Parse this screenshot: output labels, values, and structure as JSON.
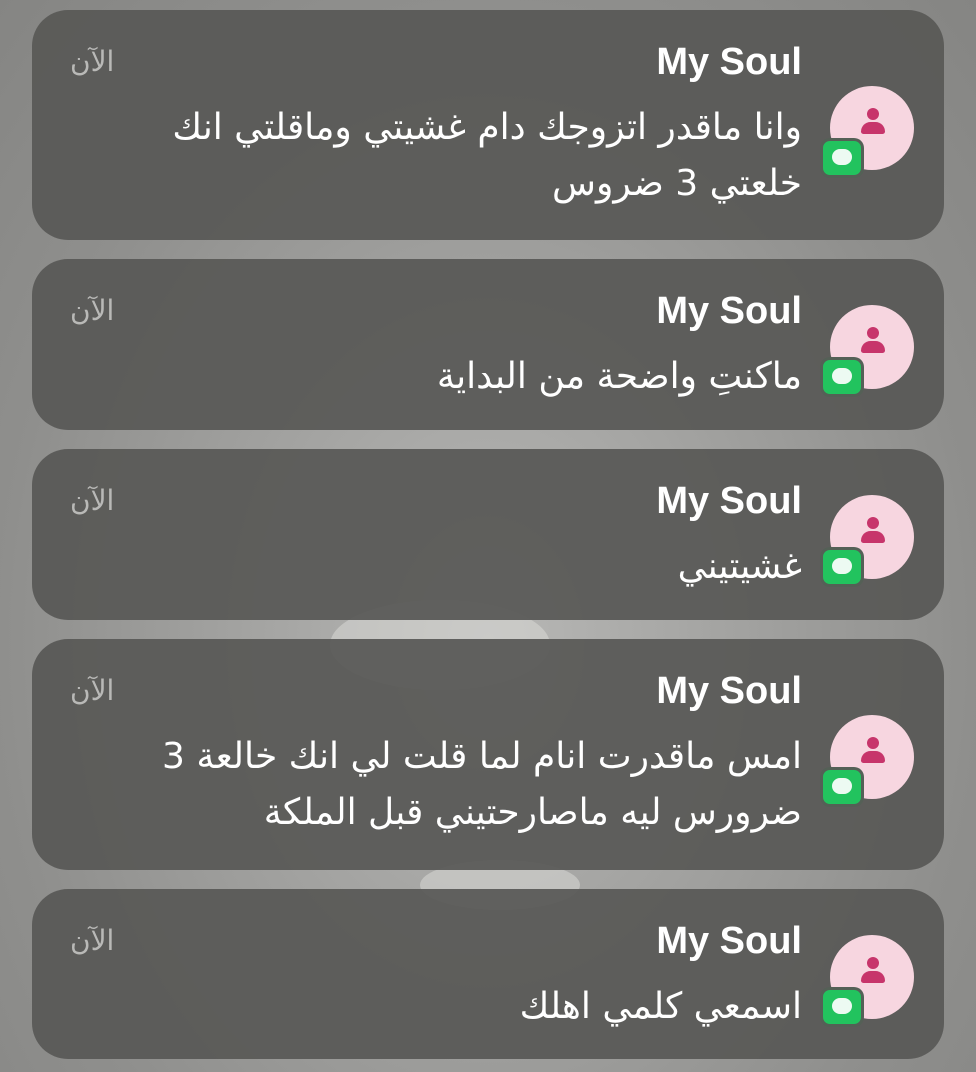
{
  "notifications": [
    {
      "sender": "My Soul",
      "time": "الآن",
      "message": "وانا ماقدر اتزوجك دام غشيتي وماقلتي انك خلعتي 3 ضروس"
    },
    {
      "sender": "My Soul",
      "time": "الآن",
      "message": "ماكنتِ واضحة من البداية"
    },
    {
      "sender": "My Soul",
      "time": "الآن",
      "message": "غشيتيني"
    },
    {
      "sender": "My Soul",
      "time": "الآن",
      "message": "امس ماقدرت انام لما قلت لي انك خالعة 3 ضرورس ليه ماصارحتيني قبل الملكة"
    },
    {
      "sender": "My Soul",
      "time": "الآن",
      "message": "اسمعي كلمي اهلك"
    }
  ],
  "icons": {
    "avatar": "person-icon",
    "app_badge": "messages-app-icon"
  },
  "colors": {
    "avatar_bg": "#f7d6e0",
    "avatar_person": "#c7356b",
    "app_badge": "#22c35e"
  }
}
